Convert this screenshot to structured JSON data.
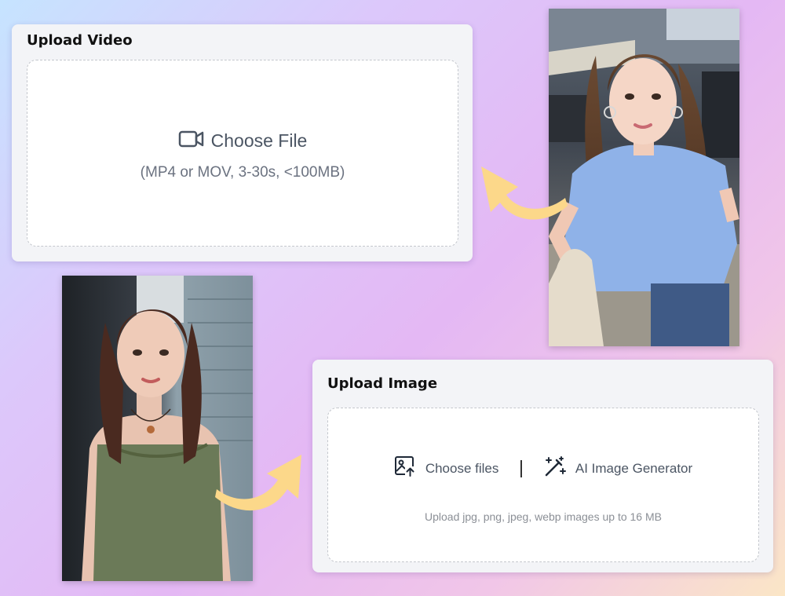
{
  "upload_video": {
    "title": "Upload Video",
    "choose_file_label": "Choose File",
    "hint": "(MP4 or MOV, 3-30s, <100MB)"
  },
  "upload_image": {
    "title": "Upload Image",
    "choose_files_label": "Choose files",
    "ai_generator_label": "AI Image Generator",
    "hint": "Upload jpg, png, jpeg, webp images up to 16 MB"
  },
  "icons": {
    "video": "video-camera-icon",
    "image_upload": "image-upload-icon",
    "magic_wand": "magic-wand-icon",
    "arrow": "curved-arrow-icon"
  },
  "colors": {
    "arrow": "#fcd88a",
    "panel_bg": "#f3f4f7",
    "dropzone_border": "#c4c7cd",
    "muted_text": "#6b7280"
  }
}
